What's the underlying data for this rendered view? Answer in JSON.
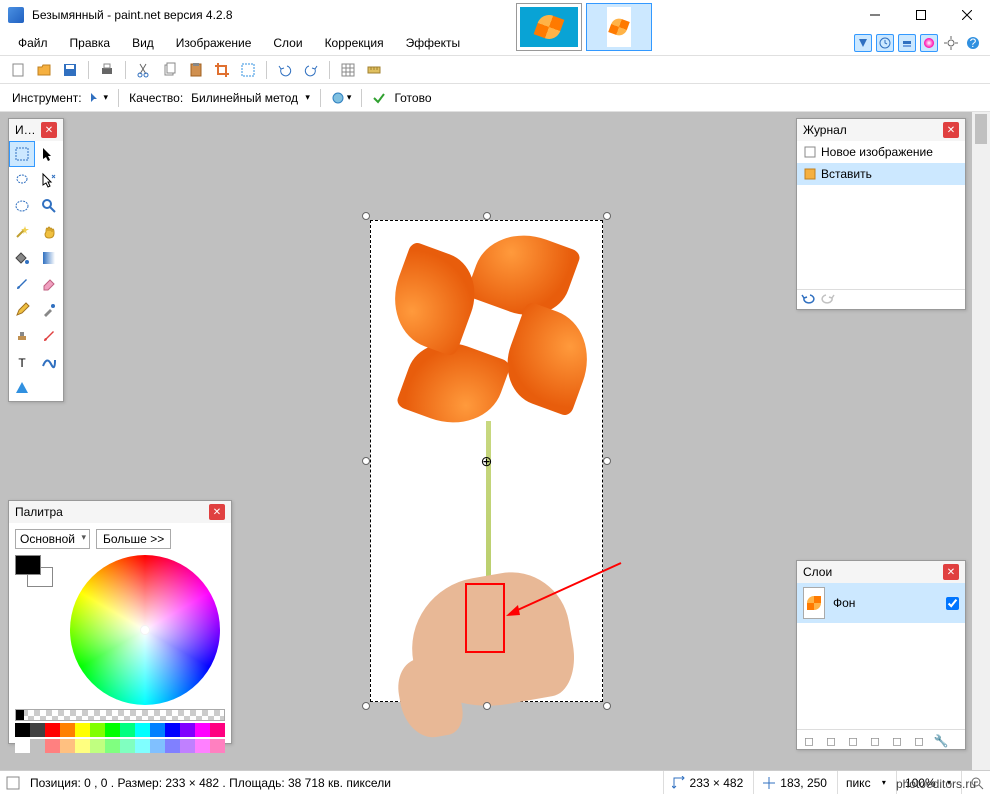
{
  "title": "Безымянный - paint.net версия 4.2.8",
  "menu": {
    "file": "Файл",
    "edit": "Правка",
    "view": "Вид",
    "image": "Изображение",
    "layers": "Слои",
    "adjustments": "Коррекция",
    "effects": "Эффекты"
  },
  "toolOptions": {
    "tool_label": "Инструмент:",
    "quality_label": "Качество:",
    "quality_value": "Билинейный метод",
    "status": "Готово"
  },
  "toolsPanel": {
    "title": "И…"
  },
  "historyPanel": {
    "title": "Журнал",
    "items": [
      {
        "label": "Новое изображение",
        "selected": false
      },
      {
        "label": "Вставить",
        "selected": true
      }
    ]
  },
  "layersPanel": {
    "title": "Слои",
    "layers": [
      {
        "name": "Фон",
        "visible": true
      }
    ]
  },
  "colorsPanel": {
    "title": "Палитра",
    "mode": "Основной",
    "more": "Больше >>",
    "front_color": "#000000",
    "back_color": "#ffffff",
    "palette": [
      "#000000",
      "#404040",
      "#ff0000",
      "#ff8000",
      "#ffff00",
      "#80ff00",
      "#00ff00",
      "#00ff80",
      "#00ffff",
      "#0080ff",
      "#0000ff",
      "#8000ff",
      "#ff00ff",
      "#ff0080",
      "#ffffff",
      "#c0c0c0",
      "#ff8080",
      "#ffc080",
      "#ffff80",
      "#c0ff80",
      "#80ff80",
      "#80ffc0",
      "#80ffff",
      "#80c0ff",
      "#8080ff",
      "#c080ff",
      "#ff80ff",
      "#ff80c0"
    ]
  },
  "statusbar": {
    "position": "Позиция: 0 , 0 . Размер: 233  × 482 . Площадь: 38 718 кв. пиксели",
    "canvas_size": "233 × 482",
    "cursor": "183, 250",
    "unit": "пикс",
    "zoom": "100%"
  },
  "watermark": "photoeditors.ru"
}
